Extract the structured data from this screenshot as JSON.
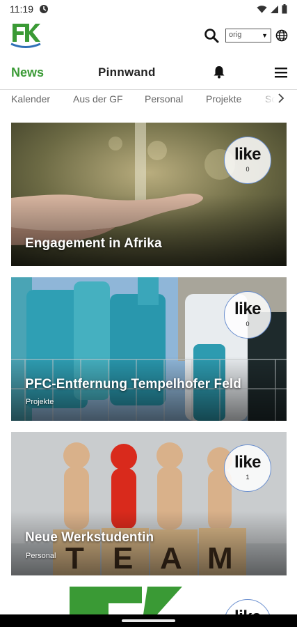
{
  "status": {
    "time": "11:19"
  },
  "header": {
    "language_value": "orig"
  },
  "nav": {
    "news": "News",
    "pinnwand": "Pinnwand"
  },
  "categories": [
    "Kalender",
    "Aus der GF",
    "Personal",
    "Projekte",
    "So"
  ],
  "cards": [
    {
      "title": "Engagement in Afrika",
      "category": "",
      "like_label": "like",
      "like_count": "0"
    },
    {
      "title": "PFC-Entfernung Tempelhofer Feld",
      "category": "Projekte",
      "like_label": "like",
      "like_count": "0"
    },
    {
      "title": "Neue Werkstudentin",
      "category": "Personal",
      "like_label": "like",
      "like_count": "1"
    },
    {
      "title": "",
      "category": "",
      "like_label": "like",
      "like_count": ""
    }
  ],
  "colors": {
    "brand_green": "#3a9a35",
    "brand_blue": "#2f6fb6",
    "like_border": "#6a8fcf"
  }
}
